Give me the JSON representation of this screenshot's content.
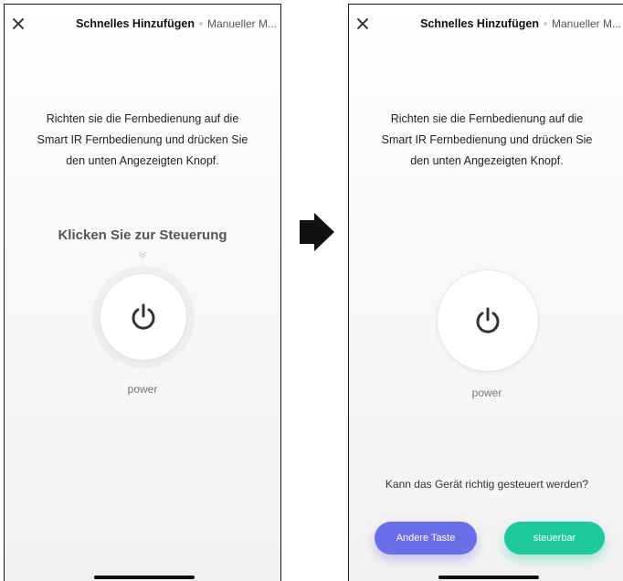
{
  "screens": [
    {
      "header": {
        "close_icon": "close-icon",
        "tab_active": "Schnelles Hinzufügen",
        "tab_inactive": "Manueller M..."
      },
      "instructions": [
        "Richten sie die Fernbedienung auf die",
        "Smart IR Fernbedienung und drücken Sie",
        "den unten Angezeigten Knopf."
      ],
      "hint": "Klicken Sie zur Steuerung",
      "power_label": "power"
    },
    {
      "header": {
        "close_icon": "close-icon",
        "tab_active": "Schnelles Hinzufügen",
        "tab_inactive": "Manueller M..."
      },
      "instructions": [
        "Richten sie die Fernbedienung auf die",
        "Smart IR Fernbedienung und drücken Sie",
        "den unten Angezeigten Knopf."
      ],
      "power_label": "power",
      "question": "Kann das Gerät richtig gesteuert werden?",
      "buttons": {
        "other": "Andere Taste",
        "ok": "steuerbar"
      }
    }
  ],
  "colors": {
    "other_button": "#6a6ee8",
    "ok_button": "#1ec99b"
  }
}
